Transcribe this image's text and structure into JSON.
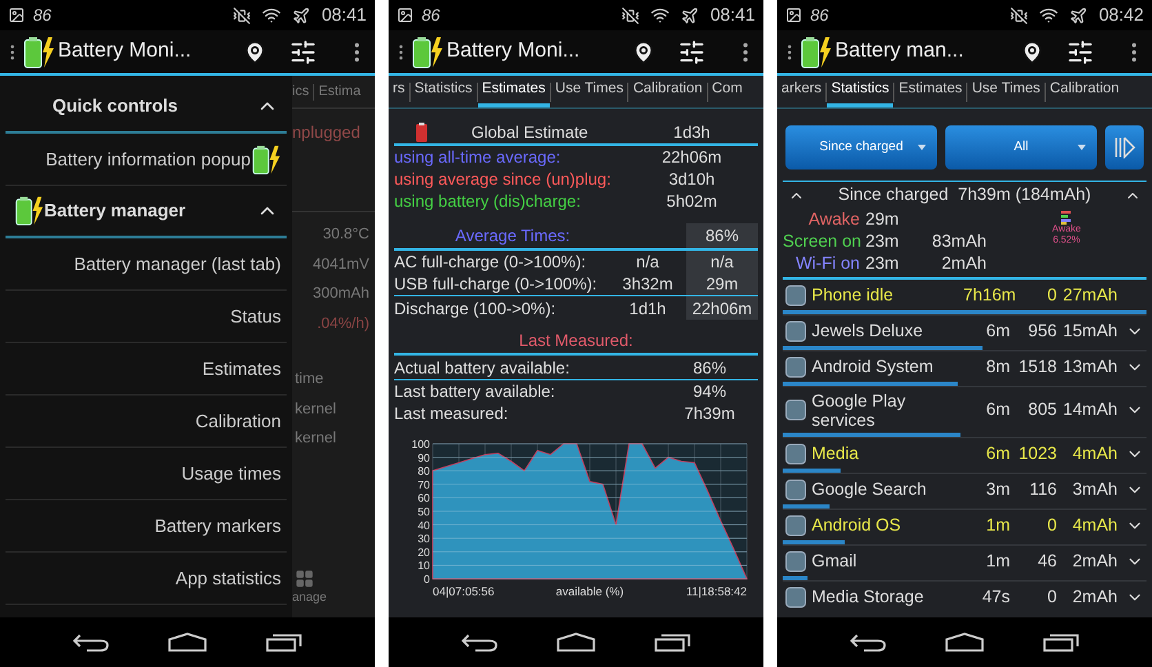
{
  "screens": [
    {
      "kind": "drawer",
      "status": {
        "battery": "86",
        "time": "08:41"
      },
      "title": "Battery Moni...",
      "drawer": {
        "sections": [
          {
            "title": "Quick controls",
            "expanded": true,
            "has_icon": false,
            "items": [
              {
                "label": "Battery information popup",
                "has_icon": true
              }
            ]
          },
          {
            "title": "Battery manager",
            "expanded": true,
            "has_icon": true,
            "items": [
              {
                "label": "Battery manager (last tab)",
                "has_icon": false
              },
              {
                "label": "Status",
                "has_icon": false
              },
              {
                "label": "Estimates",
                "has_icon": false
              },
              {
                "label": "Calibration",
                "has_icon": false
              },
              {
                "label": "Usage times",
                "has_icon": false
              },
              {
                "label": "Battery markers",
                "has_icon": false
              },
              {
                "label": "App statistics",
                "has_icon": false
              }
            ]
          }
        ]
      },
      "background_fragments": {
        "tabs": [
          "ics",
          "Estima"
        ],
        "status": "nplugged",
        "readings": [
          "30.8°C",
          "4041mV",
          "300mAh"
        ],
        "rate": ".04%/h)",
        "labels": [
          "time",
          "kernel",
          "kernel"
        ],
        "button": "anage"
      }
    },
    {
      "kind": "estimates",
      "status": {
        "battery": "86",
        "time": "08:41"
      },
      "title": "Battery Moni...",
      "tabs": [
        {
          "label": "rs",
          "selected": false
        },
        {
          "label": "Statistics",
          "selected": false
        },
        {
          "label": "Estimates",
          "selected": true
        },
        {
          "label": "Use Times",
          "selected": false
        },
        {
          "label": "Calibration",
          "selected": false
        },
        {
          "label": "Com",
          "selected": false
        }
      ],
      "global_estimate": {
        "label": "Global Estimate",
        "value": "1d3h"
      },
      "estimates": [
        {
          "label": "using all-time average:",
          "value": "22h06m",
          "color": "#6a6aff"
        },
        {
          "label": "using average since (un)plug:",
          "value": "3d10h",
          "color": "#ff5a5a"
        },
        {
          "label": "using battery (dis)charge:",
          "value": "5h02m",
          "color": "#44d044"
        }
      ],
      "average_times": {
        "title": "Average Times:",
        "level_label": "86%",
        "rows": [
          {
            "label": "AC full-charge (0->100%):",
            "value": "n/a",
            "at_level": "n/a"
          },
          {
            "label": "USB full-charge (0->100%):",
            "value": "3h32m",
            "at_level": "29m"
          },
          {
            "label": "Discharge (100->0%):",
            "value": "1d1h",
            "at_level": "22h06m"
          }
        ]
      },
      "last_measured": {
        "title": "Last Measured:",
        "rows": [
          {
            "label": "Actual battery available:",
            "value": "86%"
          },
          {
            "label": "Last battery available:",
            "value": "94%"
          },
          {
            "label": "Last measured:",
            "value": "7h39m"
          }
        ]
      },
      "chart_data": {
        "type": "area",
        "grid": true,
        "ylim": [
          0,
          100
        ],
        "yticks": [
          0,
          10,
          20,
          30,
          40,
          50,
          60,
          70,
          80,
          90,
          100
        ],
        "xlabel": "available (%)",
        "annotations": [
          "04|07:05:56",
          "11|18:58:42"
        ],
        "series": [
          {
            "color": "#2f93bd",
            "values": [
              80,
              83,
              86,
              89,
              92,
              93,
              87,
              80,
              95,
              92,
              100,
              100,
              72,
              70,
              40,
              100,
              100,
              82,
              90,
              87,
              86,
              65,
              43,
              22,
              0
            ]
          }
        ]
      }
    },
    {
      "kind": "statistics",
      "status": {
        "battery": "86",
        "time": "08:42"
      },
      "title": "Battery man...",
      "tabs": [
        {
          "label": "arkers",
          "selected": false
        },
        {
          "label": "Statistics",
          "selected": true
        },
        {
          "label": "Estimates",
          "selected": false
        },
        {
          "label": "Use Times",
          "selected": false
        },
        {
          "label": "Calibration",
          "selected": false
        }
      ],
      "filters": [
        "Since charged",
        "All"
      ],
      "summary": {
        "title": "Since charged  7h39m (184mAh)",
        "legend_label": "Awake",
        "legend_value": "6.52%"
      },
      "stats": [
        {
          "label": "Awake",
          "time": "29m",
          "color": "#e06464"
        },
        {
          "label": "Screen on",
          "time": "23m",
          "mah": "83mAh",
          "color": "#50d050"
        },
        {
          "label": "Wi-Fi on",
          "time": "23m",
          "mah": "2mAh",
          "color": "#8484ff"
        }
      ],
      "apps": [
        {
          "name": "Phone idle",
          "time": "7h16m",
          "count": "0",
          "mah": "27mAh",
          "highlight": true,
          "expandable": false,
          "level": 1
        },
        {
          "name": "Jewels Deluxe",
          "time": "6m",
          "count": "956",
          "mah": "15mAh",
          "highlight": false,
          "expandable": true,
          "level": 0.55
        },
        {
          "name": "Android System",
          "time": "8m",
          "count": "1518",
          "mah": "13mAh",
          "highlight": false,
          "expandable": true,
          "level": 0.48
        },
        {
          "name": "Google Play services",
          "time": "6m",
          "count": "805",
          "mah": "14mAh",
          "highlight": false,
          "expandable": true,
          "level": 0.49
        },
        {
          "name": "Media",
          "time": "6m",
          "count": "1023",
          "mah": "4mAh",
          "highlight": true,
          "expandable": true,
          "level": 0.16
        },
        {
          "name": "Google Search",
          "time": "3m",
          "count": "116",
          "mah": "3mAh",
          "highlight": false,
          "expandable": true,
          "level": 0.13
        },
        {
          "name": "Android OS",
          "time": "1m",
          "count": "0",
          "mah": "4mAh",
          "highlight": true,
          "expandable": true,
          "level": 0.17
        },
        {
          "name": "Gmail",
          "time": "1m",
          "count": "46",
          "mah": "2mAh",
          "highlight": false,
          "expandable": true,
          "level": 0.07
        },
        {
          "name": "Media Storage",
          "time": "47s",
          "count": "0",
          "mah": "2mAh",
          "highlight": false,
          "expandable": true
        }
      ]
    }
  ]
}
